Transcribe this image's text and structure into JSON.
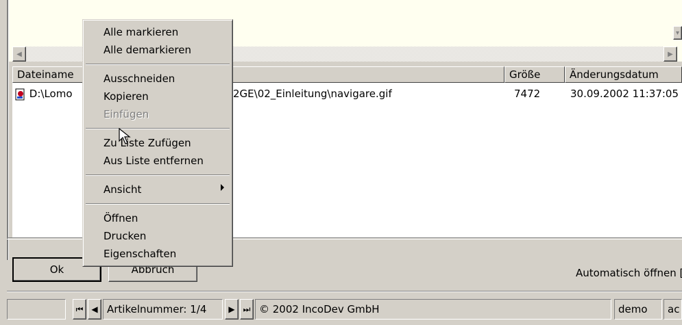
{
  "file_list": {
    "columns": [
      "Dateiname",
      "Größe",
      "Änderungsdatum"
    ],
    "rows": [
      {
        "icon": "gif-file-icon",
        "name_start": "D:\\Lomo",
        "name_end": "2GE\\02_Einleitung\\navigare.gif",
        "size": "7472",
        "date": "30.09.2002 11:37:05"
      }
    ]
  },
  "buttons": {
    "ok": "Ok",
    "cancel": "Abbruch"
  },
  "auto_open_label": "Automatisch öffnen [",
  "status_bar": {
    "record": "Artikelnummer: 1/4",
    "copyright": "© 2002 IncoDev GmbH",
    "user": "demo",
    "extra": "ac"
  },
  "context_menu": {
    "items": [
      {
        "label": "Alle markieren"
      },
      {
        "label": "Alle demarkieren"
      },
      {
        "label": "Ausschneiden"
      },
      {
        "label": "Kopieren"
      },
      {
        "label": "Einfügen",
        "disabled": true
      },
      {
        "label": "Zu Liste Zufügen"
      },
      {
        "label": "Aus Liste entfernen"
      },
      {
        "label": "Ansicht",
        "submenu": true
      },
      {
        "label": "Öffnen"
      },
      {
        "label": "Drucken"
      },
      {
        "label": "Eigenschaften"
      }
    ]
  }
}
